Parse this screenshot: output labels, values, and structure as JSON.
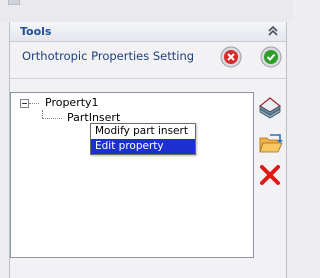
{
  "tools": {
    "title": "Tools",
    "setting_title": "Orthotropic Properties Setting"
  },
  "tree": {
    "root": {
      "label": "Property1"
    },
    "child": {
      "label": "PartInsert"
    }
  },
  "context_menu": {
    "items": [
      {
        "label": "Modify part insert",
        "selected": false
      },
      {
        "label": "Edit property",
        "selected": true
      }
    ]
  },
  "colors": {
    "header_text": "#1f4f94",
    "selection": "#1c2fd0",
    "cancel": "#d8292b",
    "ok": "#2e9e2a",
    "delete": "#e01818"
  },
  "icons": {
    "collapse": "double-chevron-up-icon",
    "cancel": "red-x-circle-icon",
    "ok": "green-check-circle-icon",
    "layers": "layers-icon",
    "open": "open-folder-icon",
    "delete": "red-x-icon"
  }
}
